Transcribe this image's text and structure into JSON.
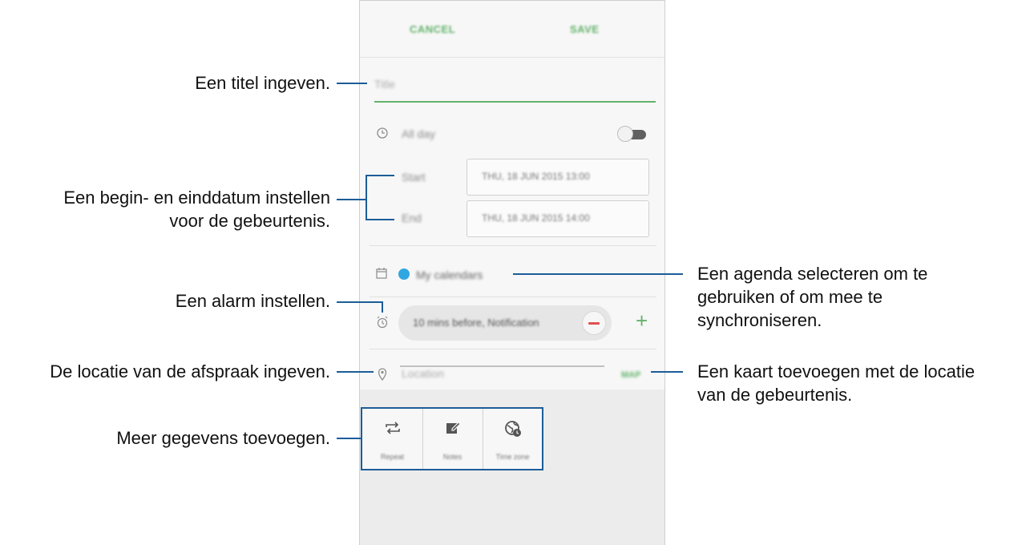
{
  "header": {
    "cancel_label": "CANCEL",
    "save_label": "SAVE"
  },
  "form": {
    "title_placeholder": "Title",
    "all_day_label": "All day",
    "start_label": "Start",
    "start_value": "THU, 18 JUN 2015 13:00",
    "end_label": "End",
    "end_value": "THU, 18 JUN 2015 14:00",
    "calendar_label": "My calendars",
    "calendar_color": "#2fa7e0",
    "alarm_value": "10 mins before, Notification",
    "location_placeholder": "Location",
    "map_label": "MAP"
  },
  "more_options": [
    {
      "label": "Repeat",
      "icon": "repeat-icon"
    },
    {
      "label": "Notes",
      "icon": "edit-note-icon"
    },
    {
      "label": "Time zone",
      "icon": "time-zone-icon"
    }
  ],
  "callouts": {
    "title": "Een titel ingeven.",
    "dates_line1": "Een begin- en einddatum instellen",
    "dates_line2": "voor de gebeurtenis.",
    "alarm": "Een alarm instellen.",
    "location": "De locatie van de afspraak ingeven.",
    "more": "Meer gegevens toevoegen.",
    "calendar_line1": "Een agenda selecteren om te",
    "calendar_line2": "gebruiken of om mee te",
    "calendar_line3": "synchroniseren.",
    "map_line1": "Een kaart toevoegen met de locatie",
    "map_line2": "van de gebeurtenis."
  },
  "colors": {
    "accent_green": "#62b36a",
    "callout_blue": "#1c5d99",
    "remove_red": "#e05050"
  }
}
